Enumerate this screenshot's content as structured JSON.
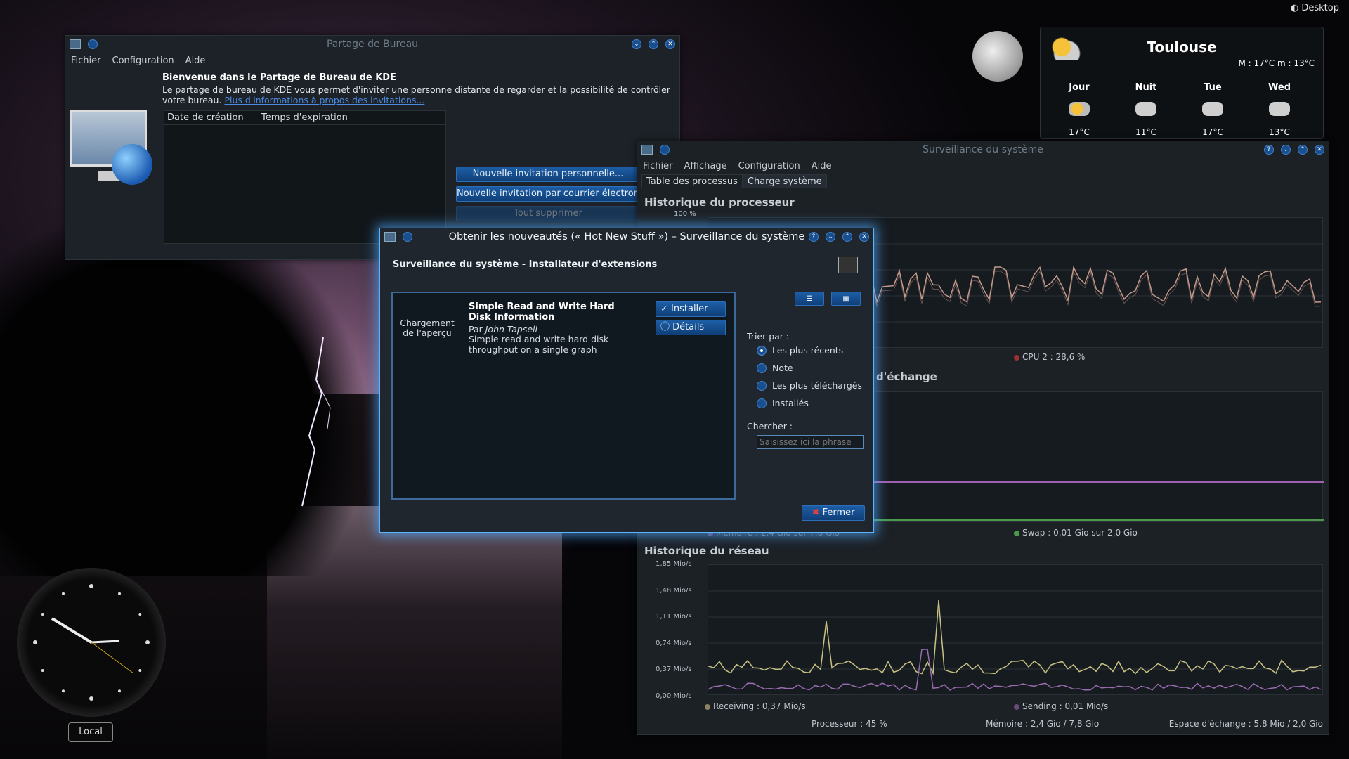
{
  "desktop": {
    "label": "Desktop",
    "clock_label": "Local"
  },
  "weather": {
    "city": "Toulouse",
    "current": "M : 17°C m : 13°C",
    "days": [
      {
        "name": "Jour",
        "temp": "17°C",
        "icon": "sun-cloud-icon"
      },
      {
        "name": "Nuit",
        "temp": "11°C",
        "icon": "cloud-icon"
      },
      {
        "name": "Tue",
        "temp": "17°C",
        "icon": "snow-icon"
      },
      {
        "name": "Wed",
        "temp": "13°C",
        "icon": "snow-icon"
      }
    ]
  },
  "krfb": {
    "title": "Partage de Bureau",
    "menu": [
      "Fichier",
      "Configuration",
      "Aide"
    ],
    "heading": "Bienvenue dans le Partage de Bureau de KDE",
    "desc": "Le partage de bureau de KDE vous permet d'inviter une personne distante de regarder et la possibilité de contrôler votre bureau.",
    "link": "Plus d'informations à propos des invitations...",
    "columns": [
      "Date de création",
      "Temps d'expiration"
    ],
    "btn_personal": "Nouvelle invitation personnelle...",
    "btn_email": "Nouvelle invitation par courrier électronique...",
    "btn_delete": "Tout supprimer"
  },
  "ksysguard": {
    "title": "Surveillance du système",
    "menu": [
      "Fichier",
      "Affichage",
      "Configuration",
      "Aide"
    ],
    "tabs": [
      "Table des processus",
      "Charge système"
    ],
    "cpu_title": "Historique du processeur",
    "cpu_axis_top": "100 %",
    "cpu_legend": "CPU 2 : 28,6 %",
    "mem_title_partial": "d'échange",
    "mem_legend_partial": "Mémoire : 2,4 Gio sur 7,8 Gio",
    "swap_legend": "Swap : 0,01 Gio sur 2,0 Gio",
    "net_title": "Historique du réseau",
    "net_axis": [
      "1,85 Mio/s",
      "1,48 Mio/s",
      "1,11 Mio/s",
      "0,74 Mio/s",
      "0,37 Mio/s",
      "0,00 Mio/s"
    ],
    "receiving": "Receiving : 0,37 Mio/s",
    "sending": "Sending : 0,01 Mio/s",
    "status": {
      "cpu": "Processeur : 45 %",
      "mem": "Mémoire : 2,4 Gio / 7,8 Gio",
      "swap": "Espace d'échange : 5,8 Mio / 2,0 Gio"
    },
    "colors": {
      "cpu": "#c49a8a",
      "receiving": "#c8c282",
      "sending": "#9a6bb0",
      "swap": "#4a9a4a",
      "mem": "#a060b0"
    }
  },
  "ghns": {
    "title": "Obtenir les nouveautés (« Hot New Stuff ») – Surveillance du système",
    "subtitle": "Surveillance du système - Installateur d'extensions",
    "preview": "Chargement de l'aperçu",
    "item": {
      "name": "Simple Read and Write Hard Disk Information",
      "by": "Par ",
      "author": "John Tapsell",
      "summary": "Simple read and write hard disk throughput on a single graph"
    },
    "install": "Installer",
    "details": "Détails",
    "sort_label": "Trier par :",
    "sort_options": [
      "Les plus récents",
      "Note",
      "Les plus téléchargés",
      "Installés"
    ],
    "search_label": "Chercher :",
    "search_placeholder": "Saisissez ici la phrase",
    "close": "Fermer"
  }
}
